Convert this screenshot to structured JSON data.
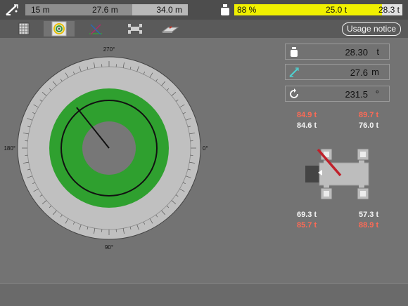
{
  "top_bar": {
    "boom_icon": "boom-length-icon",
    "boom_min": "15 m",
    "boom_current": "27.6 m",
    "boom_max": "34.0 m",
    "boom_fraction": 0.66,
    "weight_icon": "weight-icon",
    "load_percent": "88 %",
    "load_current": "25.0 t",
    "load_max": "28.3 t",
    "load_fraction": 0.88,
    "load_color": "#f0f000"
  },
  "tabs": [
    {
      "icon": "building-grid-icon"
    },
    {
      "icon": "slew-dial-icon",
      "active": true
    },
    {
      "icon": "boom-angle-icon"
    },
    {
      "icon": "outrigger-icon"
    },
    {
      "icon": "ground-pad-icon"
    }
  ],
  "usage_notice_label": "Usage notice",
  "dial": {
    "labels": {
      "top": "270°",
      "bottom": "90°",
      "left": "180°",
      "right": "0°"
    },
    "slew_angle_deg": 231.5,
    "zone_color": "#2fa02f"
  },
  "readouts": [
    {
      "icon": "weight-icon",
      "value": "28.30",
      "unit": "t"
    },
    {
      "icon": "boom-length-icon",
      "value": "27.6",
      "unit": "m"
    },
    {
      "icon": "rotation-icon",
      "value": "231.5",
      "unit": "°"
    }
  ],
  "wheel_loads": {
    "front_left_max": "84.9 t",
    "front_left": "84.6 t",
    "front_right_max": "89.7 t",
    "front_right": "76.0 t",
    "rear_left": "69.3 t",
    "rear_left_max": "85.7 t",
    "rear_right": "57.3 t",
    "rear_right_max": "88.9 t",
    "limit_color": "#ff6a55"
  }
}
